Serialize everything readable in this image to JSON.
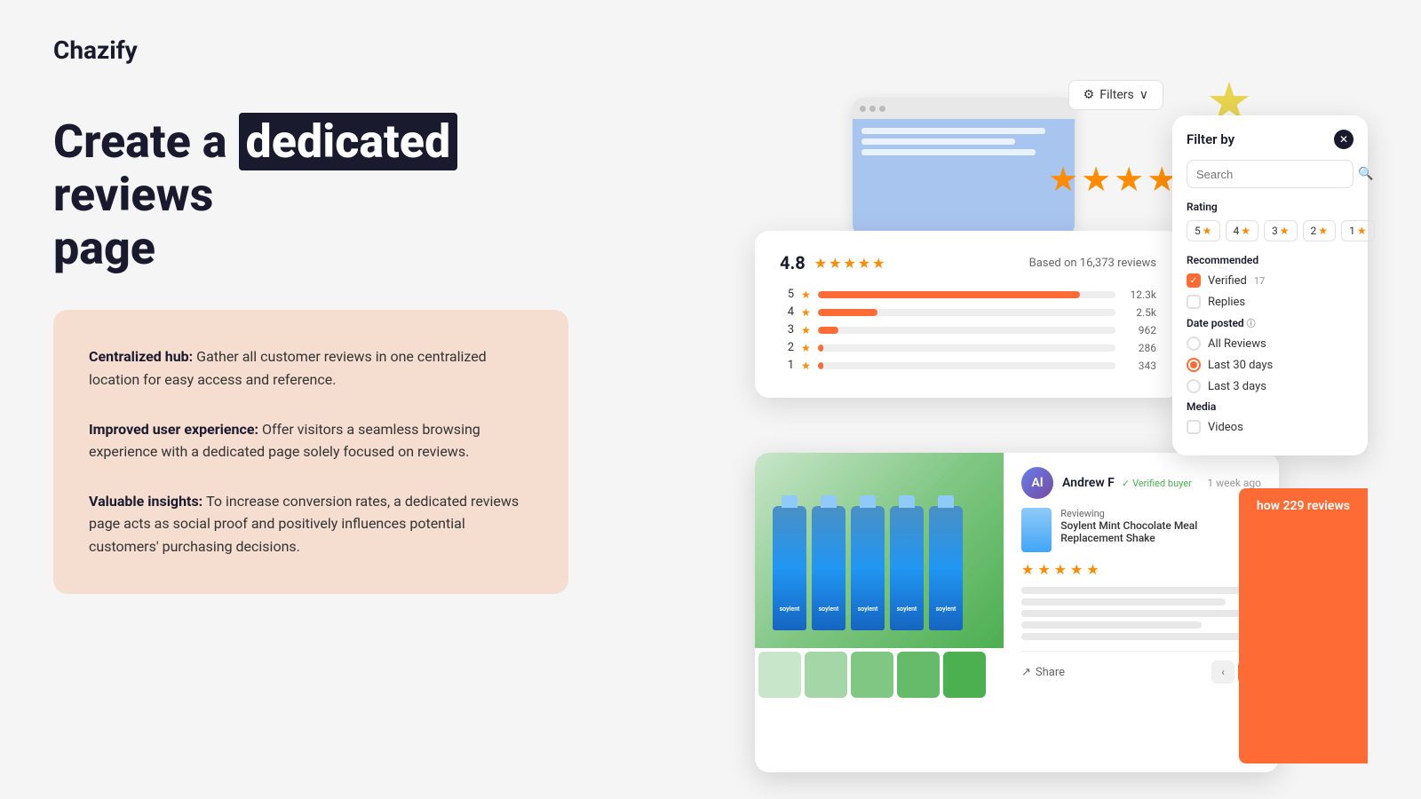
{
  "logo": {
    "text": "Chazify"
  },
  "headline": {
    "prefix": "Create a",
    "highlight": "dedicated",
    "suffix": "reviews page"
  },
  "features": [
    {
      "title": "Centralized hub:",
      "description": " Gather all customer reviews in one centralized location for easy access and reference."
    },
    {
      "title": "Improved user experience:",
      "description": " Offer visitors a seamless browsing experience with a dedicated page solely focused on reviews."
    },
    {
      "title": "Valuable insights:",
      "description": " To increase conversion rates, a dedicated reviews page acts as social proof and positively influences potential customers' purchasing decisions."
    }
  ],
  "rating_card": {
    "score": "4.8",
    "based_on": "Based on 16,373 reviews",
    "bars": [
      {
        "label": "5",
        "percent": 88,
        "count": "12.3k"
      },
      {
        "label": "4",
        "percent": 20,
        "count": "2.5k"
      },
      {
        "label": "3",
        "percent": 7,
        "count": "962"
      },
      {
        "label": "2",
        "percent": 2,
        "count": "286"
      },
      {
        "label": "1",
        "percent": 2,
        "count": "343"
      }
    ]
  },
  "filter_panel": {
    "title": "Filter by",
    "search_placeholder": "Search",
    "rating_label": "Rating",
    "rating_options": [
      "5",
      "4",
      "3",
      "2",
      "1"
    ],
    "recommended_label": "Recommended",
    "verified_label": "Verified",
    "verified_count": "17",
    "replies_label": "Replies",
    "date_posted_label": "Date posted",
    "date_options": [
      "All Reviews",
      "Last 30 days",
      "Last 3 days"
    ],
    "selected_date": "Last 30 days",
    "media_label": "Media",
    "videos_label": "Videos"
  },
  "filters_btn": {
    "label": "Filters",
    "icon": "⚙"
  },
  "review": {
    "reviewer_initials": "Al",
    "reviewer_name": "Andrew F",
    "verified_text": "Verified buyer",
    "time_ago": "1 week ago",
    "reviewing_label": "Reviewing",
    "product_name": "Soylent Mint Chocolate Meal Replacement Shake",
    "share_label": "Share"
  },
  "show_reviews_btn": {
    "label": "how 229 reviews"
  }
}
